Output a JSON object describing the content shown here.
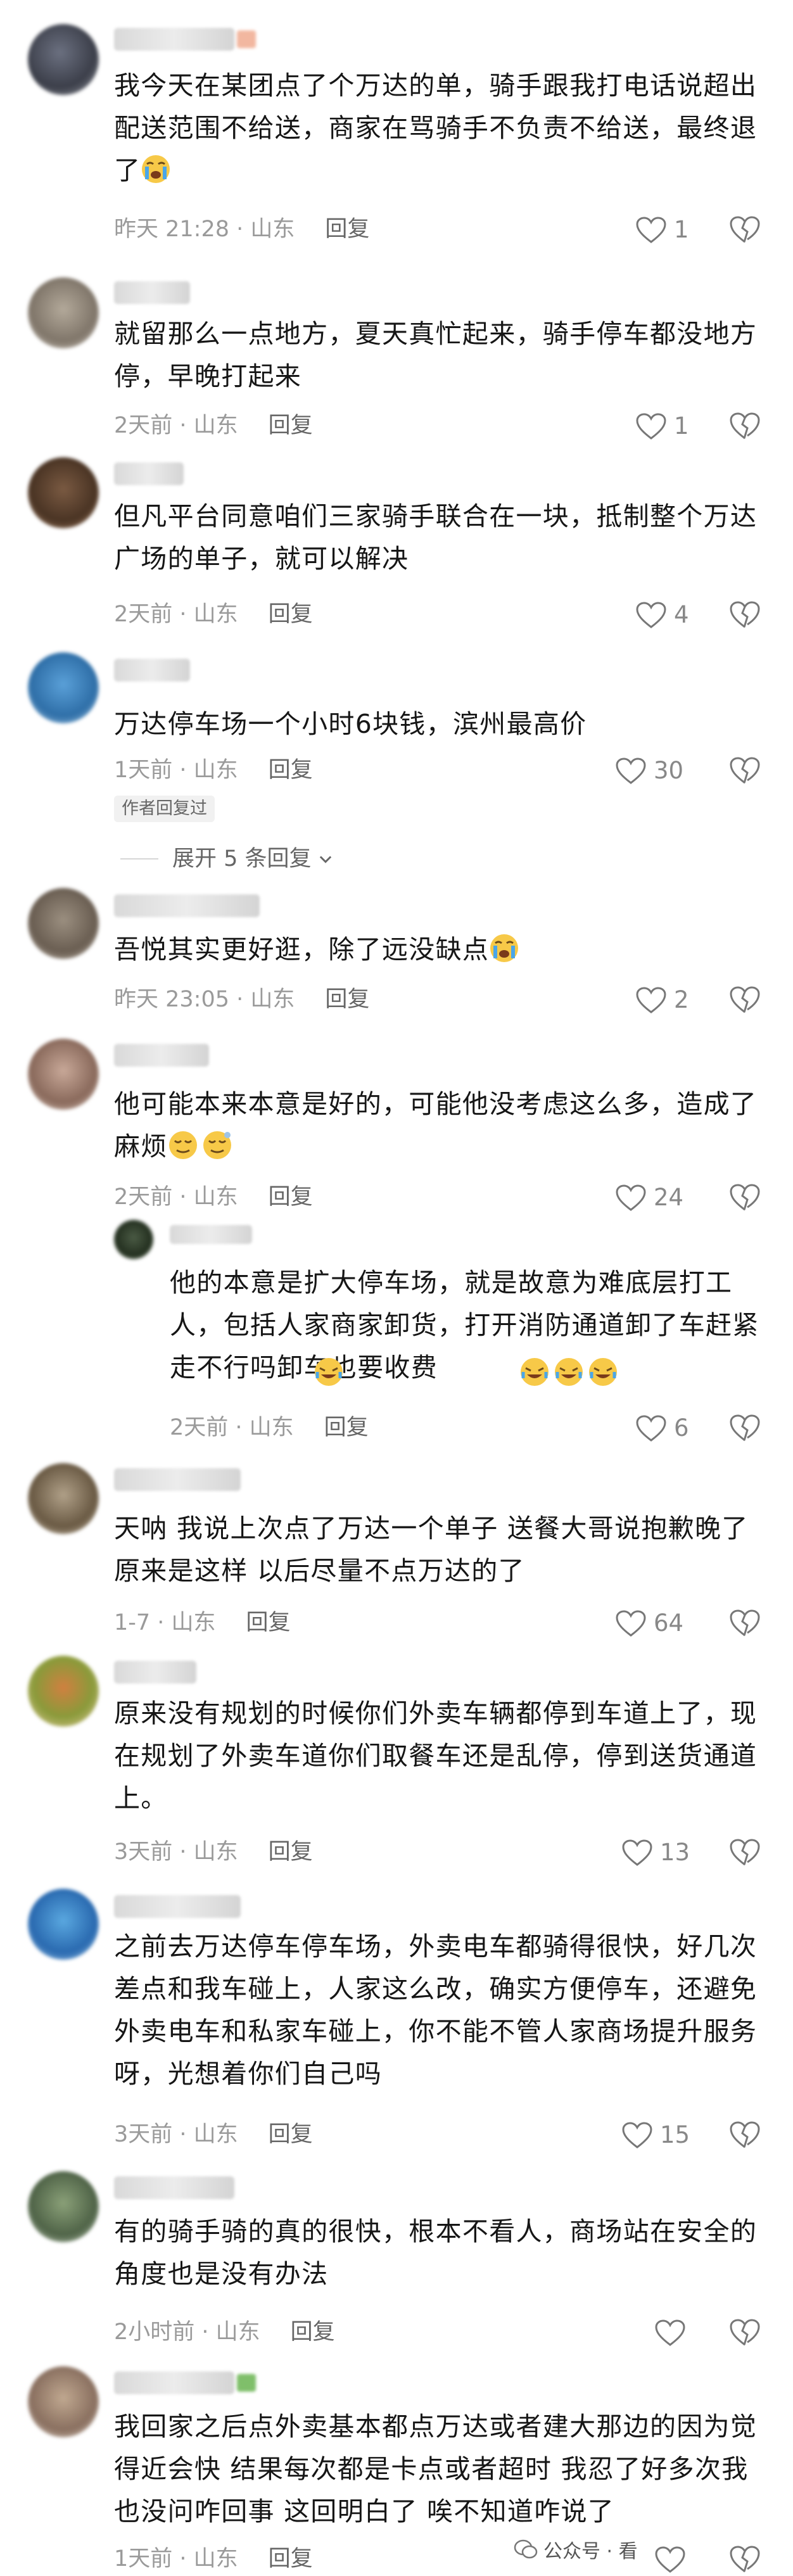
{
  "comments": [
    {
      "text": "我今天在某团点了个万达的单，骑手跟我打电话说超出配送范围不给送，商家在骂骑手不负责不给送，最终退了",
      "time": "昨天 21:28 · 山东",
      "reply": "回复",
      "likes": "1"
    },
    {
      "text": "就留那么一点地方，夏天真忙起来，骑手停车都没地方停，早晚打起来",
      "time": "2天前 · 山东",
      "reply": "回复",
      "likes": "1"
    },
    {
      "text": "但凡平台同意咱们三家骑手联合在一块，抵制整个万达广场的单子，就可以解决",
      "time": "2天前 · 山东",
      "reply": "回复",
      "likes": "4"
    },
    {
      "text": "万达停车场一个小时6块钱，滨州最高价",
      "time": "1天前 · 山东",
      "reply": "回复",
      "likes": "30",
      "badge": "作者回复过",
      "expand": "展开 5 条回复"
    },
    {
      "text": "吾悦其实更好逛，除了远没缺点",
      "time": "昨天 23:05 · 山东",
      "reply": "回复",
      "likes": "2"
    },
    {
      "text": "他可能本来本意是好的，可能他没考虑这么多，造成了麻烦",
      "time": "2天前 · 山东",
      "reply": "回复",
      "likes": "24"
    },
    {
      "text": "他的本意是扩大停车场，就是故意为难底层打工人，包括人家商家卸货，打开消防通道卸了车赶紧走不行吗卸车也要收费",
      "time": "2天前 · 山东",
      "reply": "回复",
      "likes": "6"
    },
    {
      "text": "天呐 我说上次点了万达一个单子 送餐大哥说抱歉晚了 原来是这样 以后尽量不点万达的了",
      "time": "1-7 · 山东",
      "reply": "回复",
      "likes": "64"
    },
    {
      "text": "原来没有规划的时候你们外卖车辆都停到车道上了，现在规划了外卖车道你们取餐车还是乱停，停到送货通道上。",
      "time": "3天前 · 山东",
      "reply": "回复",
      "likes": "13"
    },
    {
      "text": "之前去万达停车停车场，外卖电车都骑得很快，好几次差点和我车碰上，人家这么改，确实方便停车，还避免外卖电车和私家车碰上，你不能不管人家商场提升服务呀，光想着你们自己吗",
      "time": "3天前 · 山东",
      "reply": "回复",
      "likes": "15"
    },
    {
      "text": "有的骑手骑的真的很快，根本不看人，商场站在安全的角度也是没有办法",
      "time": "2小时前 · 山东",
      "reply": "回复",
      "likes": ""
    },
    {
      "text": "我回家之后点外卖基本都点万达或者建大那边的因为觉得近会快 结果每次都是卡点或者超时 我忍了好多次我也没问咋回事 这回明白了 唉不知道咋说了",
      "time": "1天前 · 山东",
      "reply": "回复",
      "likes": ""
    }
  ],
  "icons": {
    "like": "heart-outline-icon",
    "dislike": "broken-heart-icon",
    "emoji_cry": "loudly-crying-face-icon",
    "emoji_dizzy": "dizzy-face-icon",
    "emoji_laugh_cry": "rolling-laughing-face-icon"
  },
  "watermark": {
    "text": "公众号 · 看"
  }
}
